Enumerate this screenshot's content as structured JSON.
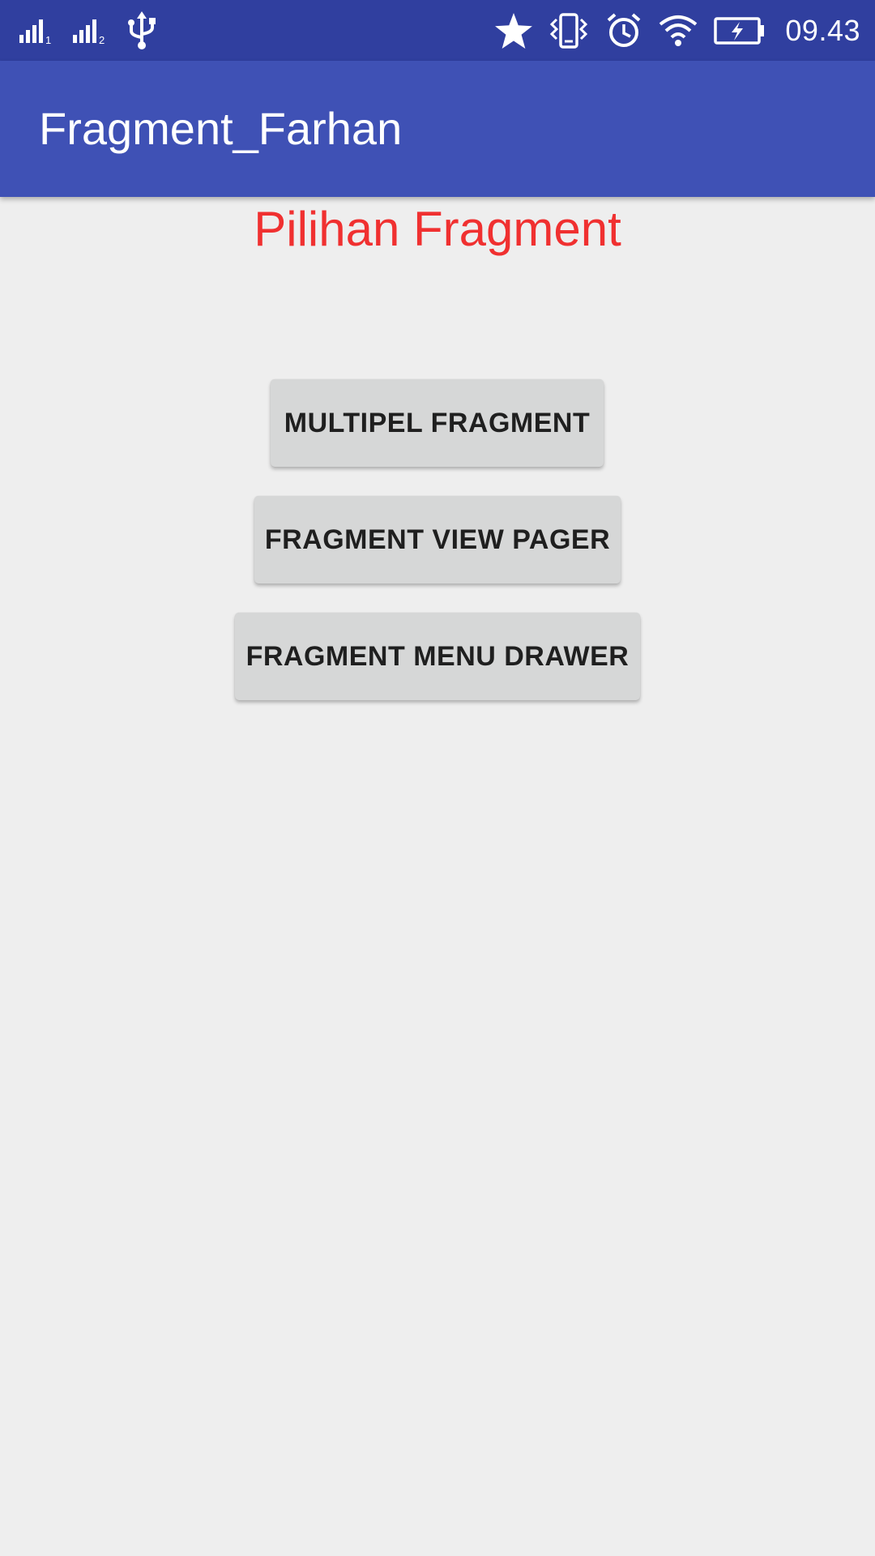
{
  "status_bar": {
    "time": "09.43",
    "sim1_label": "1",
    "sim2_label": "2",
    "icons": [
      "signal-sim1-icon",
      "signal-sim2-icon",
      "usb-icon",
      "star-icon",
      "vibrate-icon",
      "alarm-icon",
      "wifi-icon",
      "battery-charging-icon"
    ]
  },
  "app_bar": {
    "title": "Fragment_Farhan",
    "color": "#3f51b5",
    "status_color": "#303f9f"
  },
  "content": {
    "heading": "Pilihan Fragment",
    "heading_color": "#f03030",
    "buttons": [
      {
        "label": "MULTIPEL FRAGMENT"
      },
      {
        "label": "FRAGMENT VIEW PAGER"
      },
      {
        "label": "FRAGMENT MENU DRAWER"
      }
    ]
  }
}
